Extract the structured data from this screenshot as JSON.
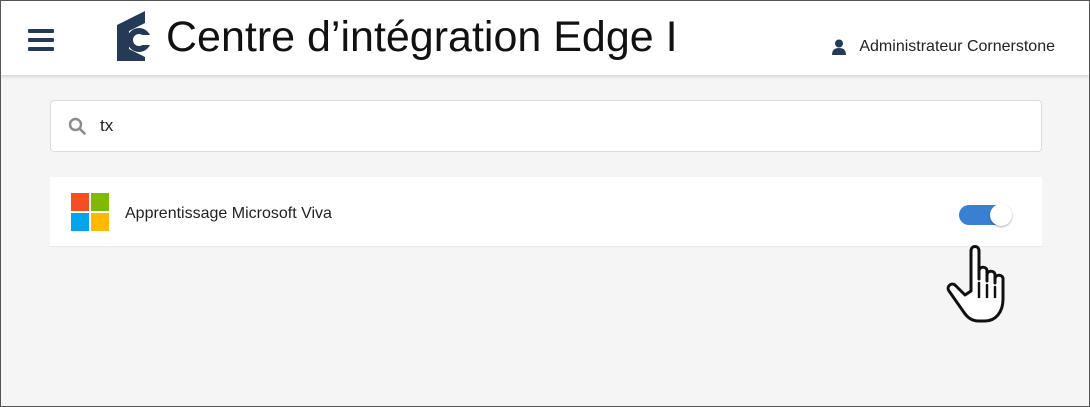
{
  "header": {
    "title": "Centre d’intégration Edge I",
    "user_name": "Administrateur Cornerstone",
    "brand_color": "#243a57"
  },
  "search": {
    "value": "tx",
    "placeholder": ""
  },
  "results": [
    {
      "name": "Apprentissage Microsoft Viva",
      "enabled": true,
      "toggle_color": "#3a80d2",
      "logo": "microsoft-logo"
    }
  ],
  "icons": {
    "menu": "hamburger-menu-icon",
    "brand": "cornerstone-logo",
    "user": "user-icon",
    "search": "search-icon",
    "pointer": "hand-pointer-cursor"
  }
}
